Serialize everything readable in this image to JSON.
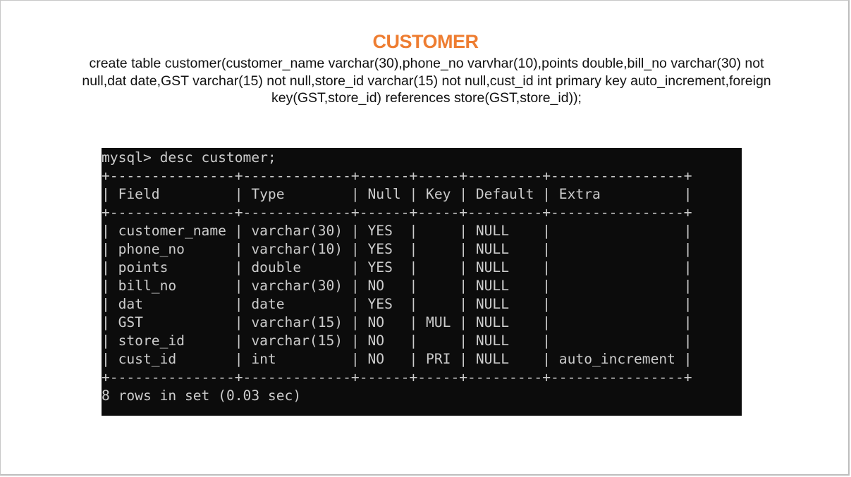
{
  "slide": {
    "title": "CUSTOMER",
    "sql_statement": "create table customer(customer_name varchar(30),phone_no varvhar(10),points double,bill_no varchar(30) not null,dat date,GST varchar(15) not null,store_id varchar(15) not null,cust_id int primary key auto_increment,foreign key(GST,store_id) references store(GST,store_id));"
  },
  "terminal": {
    "lines": [
      "mysql> desc customer;",
      "+---------------+-------------+------+-----+---------+----------------+",
      "| Field         | Type        | Null | Key | Default | Extra          |",
      "+---------------+-------------+------+-----+---------+----------------+",
      "| customer_name | varchar(30) | YES  |     | NULL    |                |",
      "| phone_no      | varchar(10) | YES  |     | NULL    |                |",
      "| points        | double      | YES  |     | NULL    |                |",
      "| bill_no       | varchar(30) | NO   |     | NULL    |                |",
      "| dat           | date        | YES  |     | NULL    |                |",
      "| GST           | varchar(15) | NO   | MUL | NULL    |                |",
      "| store_id      | varchar(15) | NO   |     | NULL    |                |",
      "| cust_id       | int         | NO   | PRI | NULL    | auto_increment |",
      "+---------------+-------------+------+-----+---------+----------------+",
      "8 rows in set (0.03 sec)"
    ]
  }
}
